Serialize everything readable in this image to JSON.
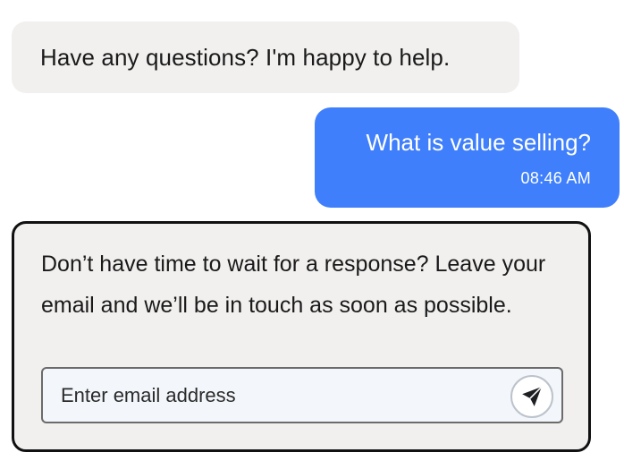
{
  "conversation": {
    "bot_greeting": "Have any questions? I'm happy to help.",
    "user_message": {
      "text": "What is value selling?",
      "time": "08:46 AM"
    }
  },
  "email_capture": {
    "prompt": "Don’t have time to wait for a response? Leave your email and we’ll be in touch as soon as possible.",
    "input_placeholder": "Enter email address",
    "input_value": "",
    "send_icon": "paper-plane-icon"
  },
  "colors": {
    "bot_bubble": "#f1f0ef",
    "user_bubble": "#3f7ffb",
    "card_border": "#111111",
    "input_background": "#f3f6fa"
  }
}
